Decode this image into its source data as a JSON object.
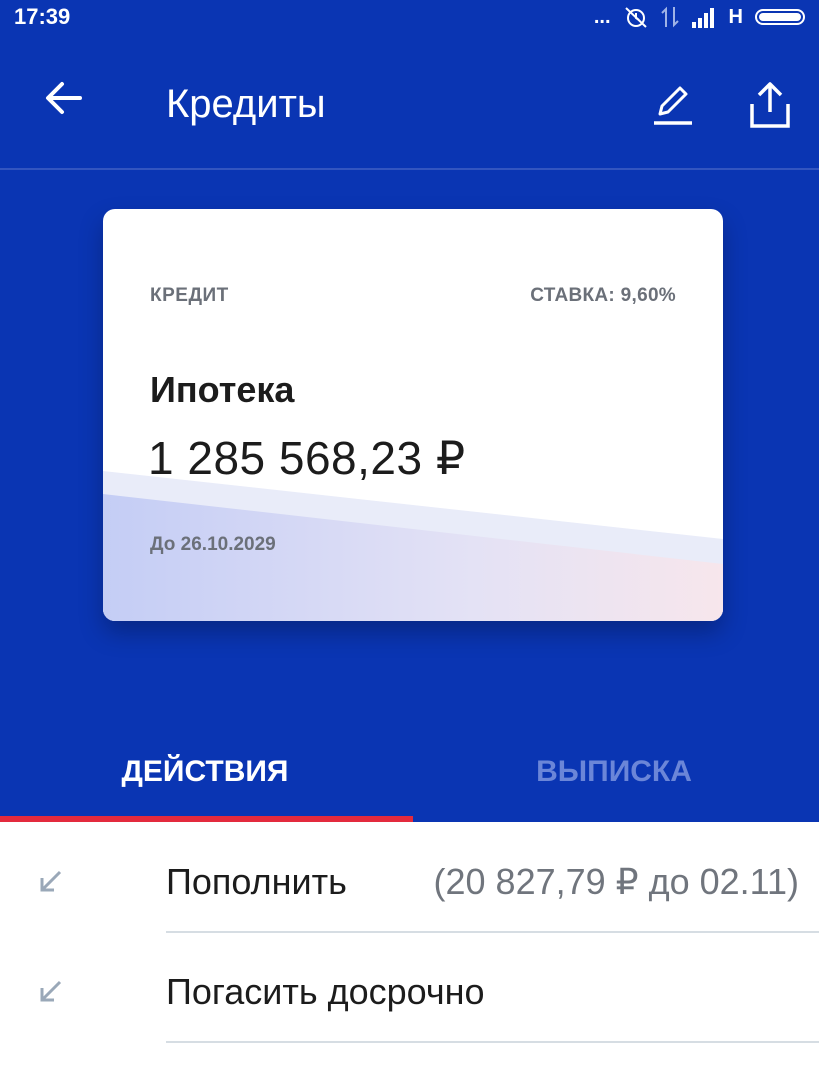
{
  "status_bar": {
    "time": "17:39",
    "dots": "...",
    "network": "H"
  },
  "header": {
    "title": "Кредиты"
  },
  "card": {
    "type_label": "КРЕДИТ",
    "rate_label": "СТАВКА: 9,60%",
    "name": "Ипотека",
    "amount": "1 285 568,23 ₽",
    "due": "До 26.10.2029"
  },
  "tabs": [
    {
      "label": "ДЕЙСТВИЯ",
      "active": true
    },
    {
      "label": "ВЫПИСКА",
      "active": false
    }
  ],
  "actions": [
    {
      "label": "Пополнить",
      "detail": "(20 827,79 ₽ до 02.11)"
    },
    {
      "label": "Погасить досрочно",
      "detail": ""
    }
  ],
  "colors": {
    "primary": "#0a35b3",
    "accent": "#e32a3d",
    "inactive_tab": "#6b86d8"
  }
}
